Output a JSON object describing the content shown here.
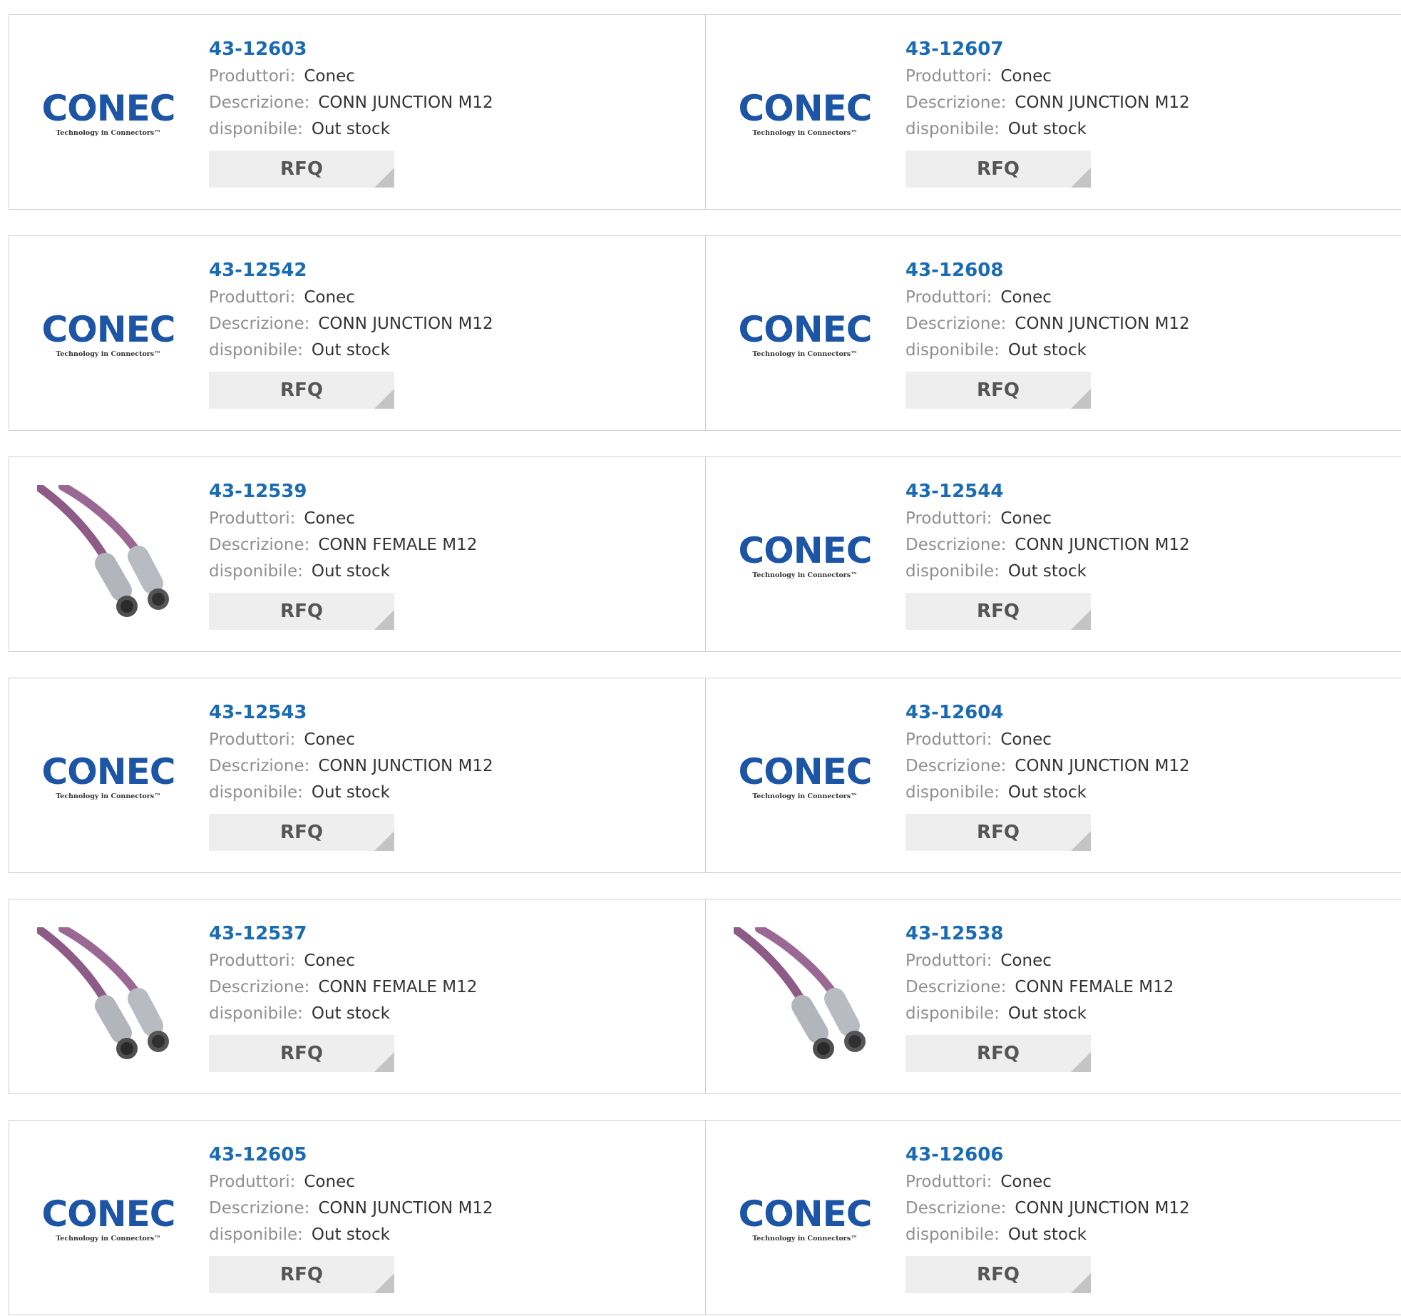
{
  "labels": {
    "manufacturer": "Produttori:",
    "description": "Descrizione:",
    "availability": "disponibile:",
    "rfq": "RFQ"
  },
  "logo": {
    "brand_text": "CONEC",
    "tagline": "Technology in Connectors™",
    "brand_color": "#1c54a6"
  },
  "colors": {
    "part_link": "#1a6bb3",
    "label": "#8f8f8f",
    "value": "#333333",
    "button_bg": "#eeeeee",
    "cable": "#8e5a86"
  },
  "products": [
    {
      "part": "43-12603",
      "manufacturer": "Conec",
      "description": "CONN JUNCTION M12",
      "availability": "Out stock",
      "image": "conec-logo"
    },
    {
      "part": "43-12607",
      "manufacturer": "Conec",
      "description": "CONN JUNCTION M12",
      "availability": "Out stock",
      "image": "conec-logo"
    },
    {
      "part": "43-12542",
      "manufacturer": "Conec",
      "description": "CONN JUNCTION M12",
      "availability": "Out stock",
      "image": "conec-logo"
    },
    {
      "part": "43-12608",
      "manufacturer": "Conec",
      "description": "CONN JUNCTION M12",
      "availability": "Out stock",
      "image": "conec-logo"
    },
    {
      "part": "43-12539",
      "manufacturer": "Conec",
      "description": "CONN FEMALE M12",
      "availability": "Out stock",
      "image": "cable-photo"
    },
    {
      "part": "43-12544",
      "manufacturer": "Conec",
      "description": "CONN JUNCTION M12",
      "availability": "Out stock",
      "image": "conec-logo"
    },
    {
      "part": "43-12543",
      "manufacturer": "Conec",
      "description": "CONN JUNCTION M12",
      "availability": "Out stock",
      "image": "conec-logo"
    },
    {
      "part": "43-12604",
      "manufacturer": "Conec",
      "description": "CONN JUNCTION M12",
      "availability": "Out stock",
      "image": "conec-logo"
    },
    {
      "part": "43-12537",
      "manufacturer": "Conec",
      "description": "CONN FEMALE M12",
      "availability": "Out stock",
      "image": "cable-photo"
    },
    {
      "part": "43-12538",
      "manufacturer": "Conec",
      "description": "CONN FEMALE M12",
      "availability": "Out stock",
      "image": "cable-photo"
    },
    {
      "part": "43-12605",
      "manufacturer": "Conec",
      "description": "CONN JUNCTION M12",
      "availability": "Out stock",
      "image": "conec-logo"
    },
    {
      "part": "43-12606",
      "manufacturer": "Conec",
      "description": "CONN JUNCTION M12",
      "availability": "Out stock",
      "image": "conec-logo"
    }
  ]
}
